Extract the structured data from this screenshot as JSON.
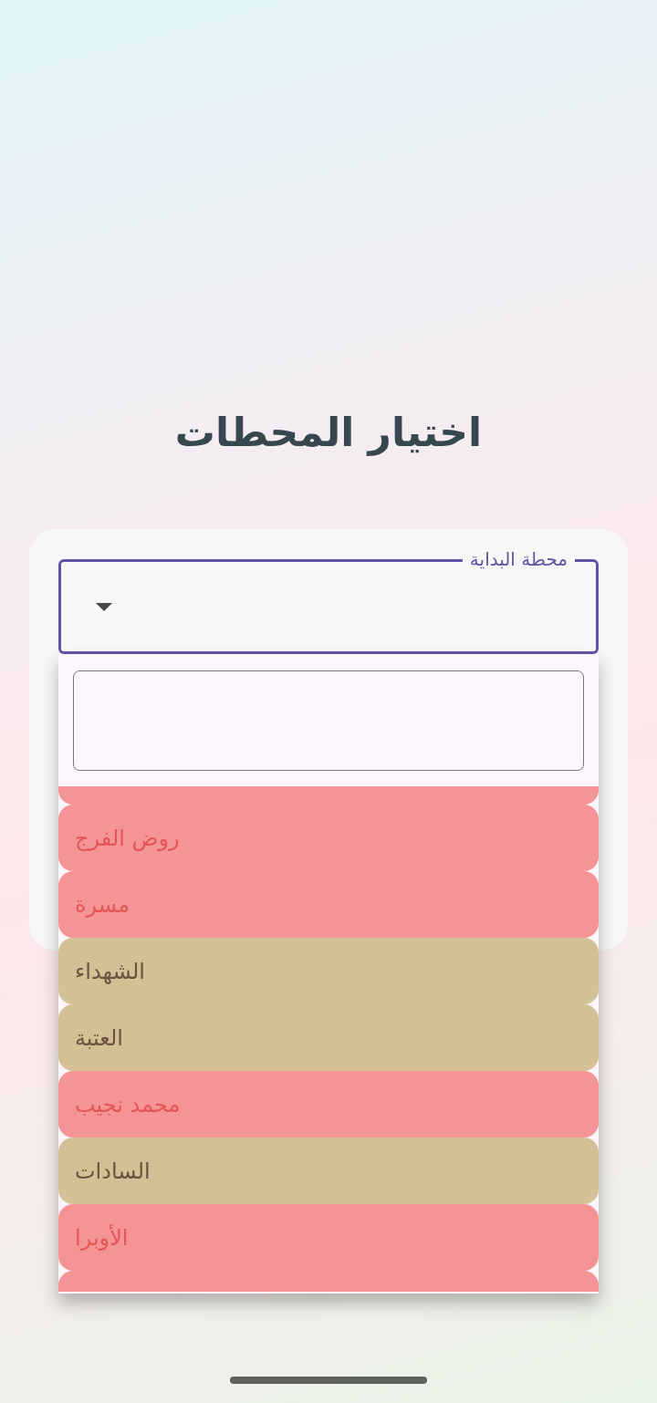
{
  "title": "اختيار المحطات",
  "start_station": {
    "label": "محطة البداية",
    "focused": true,
    "expanded": true,
    "menu": {
      "items": [
        {
          "kind": "clipped",
          "color": "#f59494"
        },
        {
          "kind": "station",
          "label": "روض الفرج",
          "color": "#f59494"
        },
        {
          "kind": "station",
          "label": "مسرة",
          "color": "#f59494"
        },
        {
          "kind": "station",
          "label": "الشهداء",
          "color": "#d4c095"
        },
        {
          "kind": "station",
          "label": "العتبة",
          "color": "#d4c095"
        },
        {
          "kind": "station",
          "label": "محمد نجيب",
          "color": "#f59494"
        },
        {
          "kind": "station",
          "label": "السادات",
          "color": "#d4c095"
        },
        {
          "kind": "station",
          "label": "الأوبرا",
          "color": "#f59494"
        },
        {
          "kind": "clipped",
          "color": "#f59494"
        }
      ]
    }
  }
}
